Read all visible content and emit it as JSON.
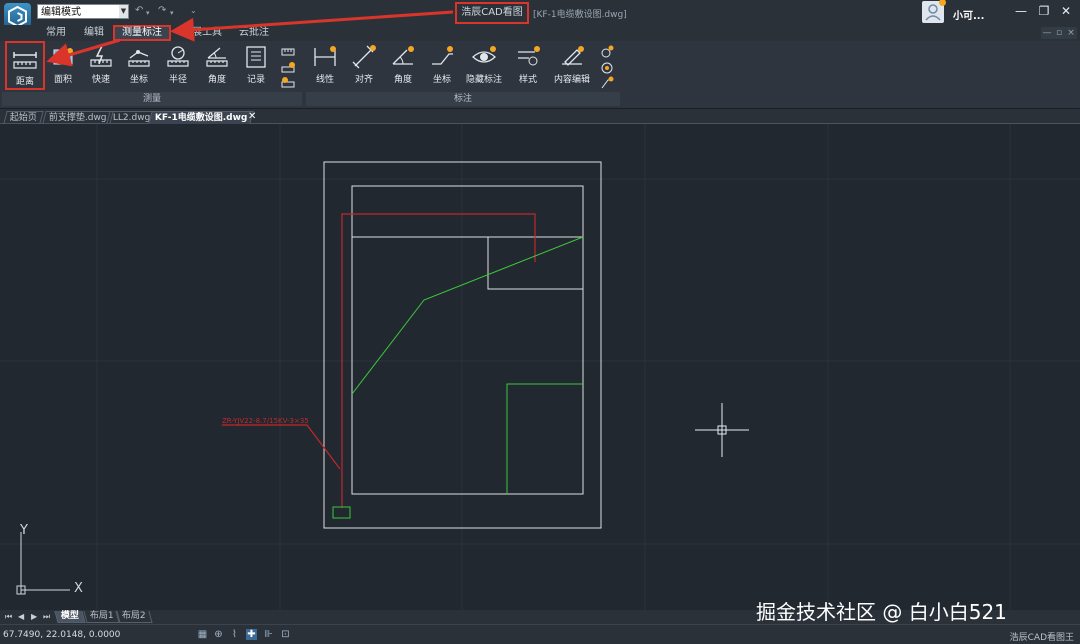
{
  "titlebar": {
    "mode_value": "编辑模式",
    "app_title": "浩辰CAD看图王",
    "doc_title": "[KF-1电缆敷设图.dwg]",
    "user_name": "小可...",
    "minimize": "—",
    "restore": "❐",
    "close": "✕"
  },
  "ribbon": {
    "tabs": [
      {
        "label": "常用"
      },
      {
        "label": "编辑"
      },
      {
        "label": "测量标注",
        "active": true
      },
      {
        "label": "扩展工具"
      },
      {
        "label": "云批注"
      }
    ],
    "measure_group": {
      "label": "测量",
      "buttons": [
        "距离",
        "面积",
        "快速",
        "坐标",
        "半径",
        "角度",
        "记录"
      ]
    },
    "annotate_group": {
      "label": "标注",
      "buttons": [
        "线性",
        "对齐",
        "角度",
        "坐标",
        "隐藏标注",
        "样式",
        "内容编辑"
      ]
    }
  },
  "doc_tabs": [
    {
      "label": "起始页"
    },
    {
      "label": "前支撑垫.dwg"
    },
    {
      "label": "LL2.dwg"
    },
    {
      "label": "KF-1电缆敷设图.dwg",
      "active": true
    }
  ],
  "drawing": {
    "annotation_text": "ZR-YJV22-8.7/15KV-3×35"
  },
  "axis": {
    "y": "Y",
    "x": "X"
  },
  "layout_tabs": [
    {
      "label": "模型",
      "active": true
    },
    {
      "label": "布局1"
    },
    {
      "label": "布局2"
    }
  ],
  "watermark": "掘金技术社区 @ 白小白521",
  "statusbar": {
    "coords": "67.7490, 22.0148, 0.0000",
    "product": "浩辰CAD看图王"
  },
  "colors": {
    "canvas_bg": "#212830",
    "highlight_red": "#d9352b",
    "drawing_white": "#e0e0e0",
    "drawing_red": "#c0282c",
    "drawing_green": "#3cc83c"
  }
}
